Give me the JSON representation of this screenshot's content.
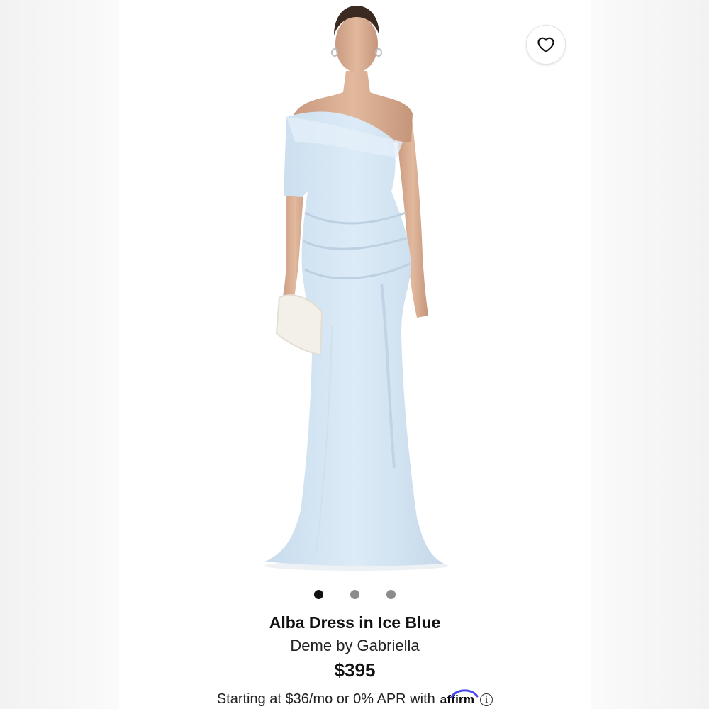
{
  "product": {
    "name": "Alba Dress in Ice Blue",
    "brand": "Deme by Gabriella",
    "price": "$395",
    "dress_color": "#d6e6f3"
  },
  "gallery": {
    "image_count": 3,
    "active_index": 0
  },
  "favorite": {
    "icon": "heart-outline-icon"
  },
  "financing": {
    "text": "Starting at $36/mo or 0% APR with",
    "provider_logo": "affirm",
    "info_icon": "info-icon"
  },
  "colors": {
    "accent_affirm": "#4a4af4",
    "dot_active": "#111111",
    "dot_inactive": "#8c8c8c"
  }
}
